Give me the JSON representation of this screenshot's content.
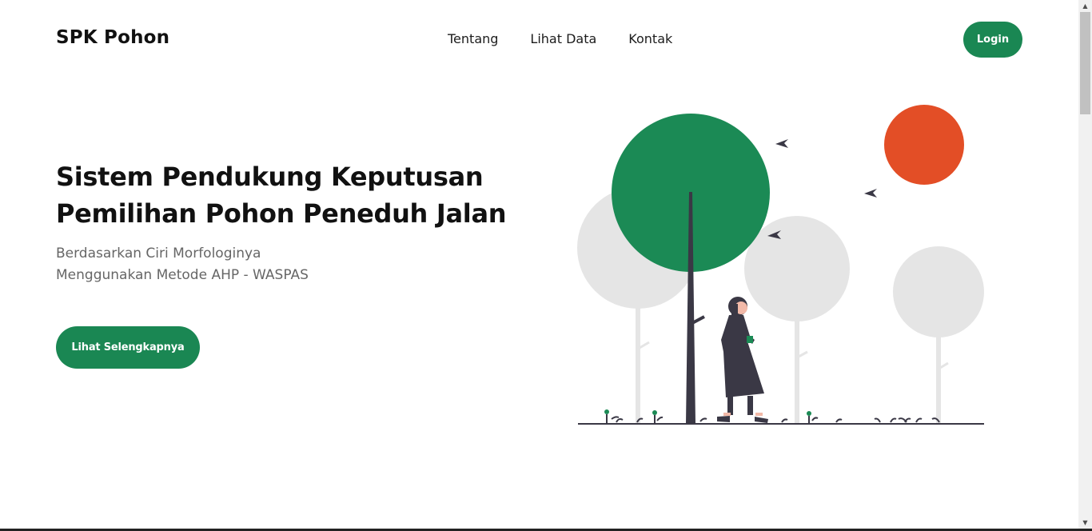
{
  "navbar": {
    "brand": "SPK Pohon",
    "links": [
      "Tentang",
      "Lihat Data",
      "Kontak"
    ],
    "login_label": "Login"
  },
  "hero": {
    "title_lines": [
      "Sistem Pendukung Keputusan",
      "Pemilihan Pohon Peneduh Jalan"
    ],
    "subtitle_lines": [
      "Berdasarkan Ciri Morfologinya",
      "Menggunakan Metode AHP - WASPAS"
    ],
    "cta_label": "Lihat Selengkapnya"
  },
  "colors": {
    "primary": "#1a8753",
    "tree_green": "#1b8a55",
    "sun": "#e34e26",
    "figure": "#3a3845",
    "grey_tree": "#e5e5e5"
  },
  "icons": {
    "illustration": "person-walking-among-trees-illustration",
    "scroll_up": "chevron-up-icon",
    "scroll_down": "chevron-down-icon"
  }
}
